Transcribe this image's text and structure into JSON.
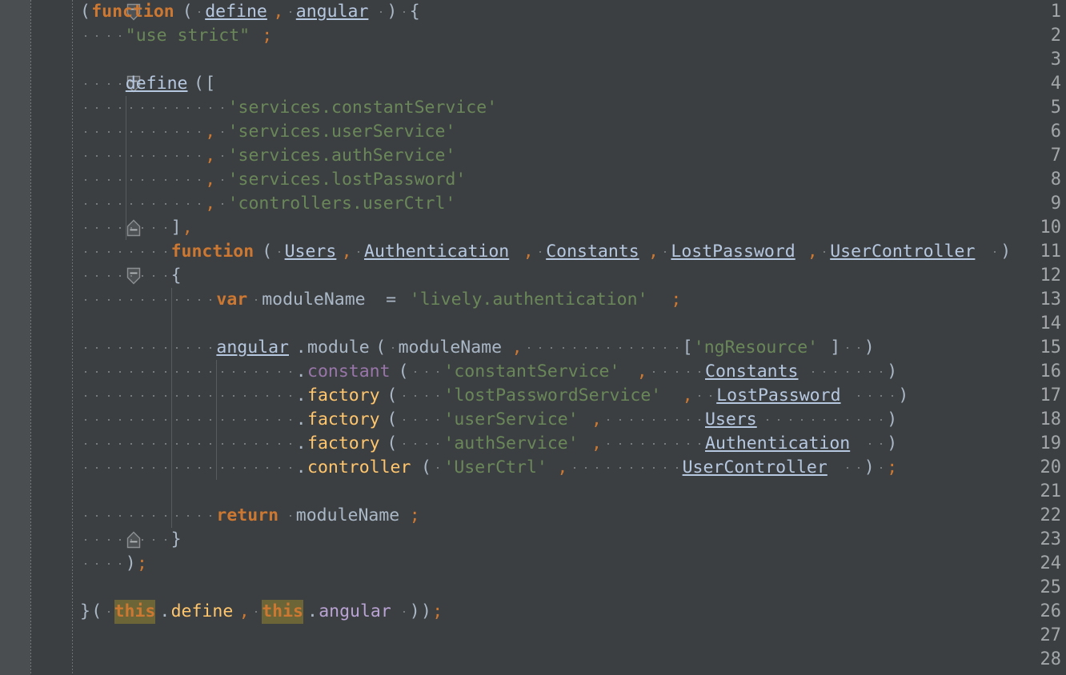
{
  "editor": {
    "theme_name": "darcula",
    "colors": {
      "background": "#3c3f41",
      "gutter_background": "#4b4e50",
      "line_number": "#a3a6a8",
      "default_text": "#a9b7c6",
      "keyword": "#cc7832",
      "string": "#6a8759",
      "function_name": "#ffc66d",
      "purple_method": "#9876aa",
      "parameter_underlined": "#b6c7e0",
      "this_highlight_background": "#6b6538",
      "indent_guide": "#585b5d",
      "whitespace_dot": "#787b7d"
    },
    "total_lines": 28,
    "first_visible_line": 1,
    "language": "JavaScript",
    "show_whitespace_dots": true,
    "show_indent_guides": true,
    "char_width": 14.2,
    "line_height": 30
  },
  "gutter": {
    "line_numbers": [
      1,
      2,
      3,
      4,
      5,
      6,
      7,
      8,
      9,
      10,
      11,
      12,
      13,
      14,
      15,
      16,
      17,
      18,
      19,
      20,
      21,
      22,
      23,
      24,
      25,
      26,
      27,
      28
    ],
    "fold_markers": [
      {
        "line": 1,
        "type": "fold-start",
        "icon": "fold-collapse-icon"
      },
      {
        "line": 4,
        "type": "fold-start",
        "icon": "fold-collapse-icon"
      },
      {
        "line": 10,
        "type": "fold-end",
        "icon": "fold-end-icon"
      },
      {
        "line": 12,
        "type": "fold-start",
        "icon": "fold-collapse-icon"
      },
      {
        "line": 23,
        "type": "fold-end",
        "icon": "fold-end-icon"
      },
      {
        "line": 26,
        "type": "fold-end",
        "icon": "fold-end-icon"
      }
    ]
  },
  "code": {
    "lines": [
      {
        "n": 1,
        "indent": 0,
        "guides": [],
        "tokens": [
          {
            "t": "(",
            "c": "punc"
          },
          {
            "t": "function",
            "c": "kw"
          },
          {
            "t": "(",
            "c": "punc"
          },
          {
            "t": " ",
            "c": "punc"
          },
          {
            "t": "define",
            "c": "param"
          },
          {
            "t": ",",
            "c": "comma"
          },
          {
            "t": " ",
            "c": "punc"
          },
          {
            "t": "angular",
            "c": "param"
          },
          {
            "t": " ",
            "c": "punc"
          },
          {
            "t": ")",
            "c": "punc"
          },
          {
            "t": " ",
            "c": "punc"
          },
          {
            "t": "{",
            "c": "punc"
          }
        ]
      },
      {
        "n": 2,
        "indent": 0,
        "guides": [],
        "tokens": [
          {
            "t": "    ",
            "c": "punc"
          },
          {
            "t": "\"use strict\"",
            "c": "str"
          },
          {
            "t": ";",
            "c": "comma"
          }
        ]
      },
      {
        "n": 3,
        "indent": 0,
        "guides": [],
        "tokens": []
      },
      {
        "n": 4,
        "indent": 0,
        "guides": [],
        "tokens": [
          {
            "t": "    ",
            "c": "punc"
          },
          {
            "t": "define",
            "c": "defunder"
          },
          {
            "t": "(",
            "c": "punc"
          },
          {
            "t": "[",
            "c": "punc"
          }
        ]
      },
      {
        "n": 5,
        "indent": 0,
        "guides": [
          4
        ],
        "tokens": [
          {
            "t": "             ",
            "c": "punc"
          },
          {
            "t": "'services.constantService'",
            "c": "str"
          }
        ]
      },
      {
        "n": 6,
        "indent": 0,
        "guides": [
          4
        ],
        "tokens": [
          {
            "t": "           ",
            "c": "punc"
          },
          {
            "t": ",",
            "c": "comma"
          },
          {
            "t": " ",
            "c": "punc"
          },
          {
            "t": "'services.userService'",
            "c": "str"
          }
        ]
      },
      {
        "n": 7,
        "indent": 0,
        "guides": [
          4
        ],
        "tokens": [
          {
            "t": "           ",
            "c": "punc"
          },
          {
            "t": ",",
            "c": "comma"
          },
          {
            "t": " ",
            "c": "punc"
          },
          {
            "t": "'services.authService'",
            "c": "str"
          }
        ]
      },
      {
        "n": 8,
        "indent": 0,
        "guides": [
          4
        ],
        "tokens": [
          {
            "t": "           ",
            "c": "punc"
          },
          {
            "t": ",",
            "c": "comma"
          },
          {
            "t": " ",
            "c": "punc"
          },
          {
            "t": "'services.lostPassword'",
            "c": "str"
          }
        ]
      },
      {
        "n": 9,
        "indent": 0,
        "guides": [
          4
        ],
        "tokens": [
          {
            "t": "           ",
            "c": "punc"
          },
          {
            "t": ",",
            "c": "comma"
          },
          {
            "t": " ",
            "c": "punc"
          },
          {
            "t": "'controllers.userCtrl'",
            "c": "str"
          }
        ]
      },
      {
        "n": 10,
        "indent": 0,
        "guides": [
          4
        ],
        "tokens": [
          {
            "t": "        ",
            "c": "punc"
          },
          {
            "t": "]",
            "c": "punc"
          },
          {
            "t": ",",
            "c": "comma"
          }
        ]
      },
      {
        "n": 11,
        "indent": 0,
        "guides": [],
        "tokens": [
          {
            "t": "        ",
            "c": "punc"
          },
          {
            "t": "function",
            "c": "kw"
          },
          {
            "t": "(",
            "c": "punc"
          },
          {
            "t": " ",
            "c": "punc"
          },
          {
            "t": "Users",
            "c": "param"
          },
          {
            "t": ",",
            "c": "comma"
          },
          {
            "t": " ",
            "c": "punc"
          },
          {
            "t": "Authentication",
            "c": "param"
          },
          {
            "t": ",",
            "c": "comma"
          },
          {
            "t": " ",
            "c": "punc"
          },
          {
            "t": "Constants",
            "c": "param"
          },
          {
            "t": ",",
            "c": "comma"
          },
          {
            "t": " ",
            "c": "punc"
          },
          {
            "t": "LostPassword",
            "c": "param"
          },
          {
            "t": ",",
            "c": "comma"
          },
          {
            "t": " ",
            "c": "punc"
          },
          {
            "t": "UserController",
            "c": "param"
          },
          {
            "t": " ",
            "c": "punc"
          },
          {
            "t": ")",
            "c": "punc"
          }
        ]
      },
      {
        "n": 12,
        "indent": 0,
        "guides": [],
        "tokens": [
          {
            "t": "        ",
            "c": "punc"
          },
          {
            "t": "{",
            "c": "punc"
          }
        ]
      },
      {
        "n": 13,
        "indent": 0,
        "guides": [
          8
        ],
        "tokens": [
          {
            "t": "            ",
            "c": "punc"
          },
          {
            "t": "var",
            "c": "kw"
          },
          {
            "t": " ",
            "c": "punc"
          },
          {
            "t": "moduleName",
            "c": "ident"
          },
          {
            "t": " = ",
            "c": "punc"
          },
          {
            "t": "'lively.authentication'",
            "c": "str"
          },
          {
            "t": ";",
            "c": "comma"
          }
        ]
      },
      {
        "n": 14,
        "indent": 0,
        "guides": [
          8
        ],
        "tokens": []
      },
      {
        "n": 15,
        "indent": 0,
        "guides": [
          8
        ],
        "tokens": [
          {
            "t": "            ",
            "c": "punc"
          },
          {
            "t": "angular",
            "c": "defunder"
          },
          {
            "t": ".",
            "c": "punc"
          },
          {
            "t": "module",
            "c": "ident"
          },
          {
            "t": "(",
            "c": "punc"
          },
          {
            "t": " ",
            "c": "punc"
          },
          {
            "t": "moduleName",
            "c": "ident"
          },
          {
            "t": ",",
            "c": "comma"
          },
          {
            "t": "              ",
            "c": "punc"
          },
          {
            "t": "[",
            "c": "punc"
          },
          {
            "t": "'ngResource'",
            "c": "str"
          },
          {
            "t": "]",
            "c": "punc"
          },
          {
            "t": "  ",
            "c": "punc"
          },
          {
            "t": ")",
            "c": "punc"
          }
        ]
      },
      {
        "n": 16,
        "indent": 0,
        "guides": [
          8,
          12
        ],
        "tokens": [
          {
            "t": "                   ",
            "c": "punc"
          },
          {
            "t": ".",
            "c": "punc"
          },
          {
            "t": "constant",
            "c": "fnpurple"
          },
          {
            "t": "(",
            "c": "punc"
          },
          {
            "t": "   ",
            "c": "punc"
          },
          {
            "t": "'constantService'",
            "c": "str"
          },
          {
            "t": ",",
            "c": "comma"
          },
          {
            "t": "     ",
            "c": "punc"
          },
          {
            "t": "Constants",
            "c": "param"
          },
          {
            "t": "       ",
            "c": "punc"
          },
          {
            "t": ")",
            "c": "punc"
          }
        ]
      },
      {
        "n": 17,
        "indent": 0,
        "guides": [
          8,
          12
        ],
        "tokens": [
          {
            "t": "                   ",
            "c": "punc"
          },
          {
            "t": ".",
            "c": "punc"
          },
          {
            "t": "factory",
            "c": "fnorange"
          },
          {
            "t": "(",
            "c": "punc"
          },
          {
            "t": "    ",
            "c": "punc"
          },
          {
            "t": "'lostPasswordService'",
            "c": "str"
          },
          {
            "t": ",",
            "c": "comma"
          },
          {
            "t": "  ",
            "c": "punc"
          },
          {
            "t": "LostPassword",
            "c": "param"
          },
          {
            "t": "    ",
            "c": "punc"
          },
          {
            "t": ")",
            "c": "punc"
          }
        ]
      },
      {
        "n": 18,
        "indent": 0,
        "guides": [
          8,
          12
        ],
        "tokens": [
          {
            "t": "                   ",
            "c": "punc"
          },
          {
            "t": ".",
            "c": "punc"
          },
          {
            "t": "factory",
            "c": "fnorange"
          },
          {
            "t": "(",
            "c": "punc"
          },
          {
            "t": "    ",
            "c": "punc"
          },
          {
            "t": "'userService'",
            "c": "str"
          },
          {
            "t": ",",
            "c": "comma"
          },
          {
            "t": "         ",
            "c": "punc"
          },
          {
            "t": "Users",
            "c": "param"
          },
          {
            "t": "           ",
            "c": "punc"
          },
          {
            "t": ")",
            "c": "punc"
          }
        ]
      },
      {
        "n": 19,
        "indent": 0,
        "guides": [
          8,
          12
        ],
        "tokens": [
          {
            "t": "                   ",
            "c": "punc"
          },
          {
            "t": ".",
            "c": "punc"
          },
          {
            "t": "factory",
            "c": "fnorange"
          },
          {
            "t": "(",
            "c": "punc"
          },
          {
            "t": "    ",
            "c": "punc"
          },
          {
            "t": "'authService'",
            "c": "str"
          },
          {
            "t": ",",
            "c": "comma"
          },
          {
            "t": "         ",
            "c": "punc"
          },
          {
            "t": "Authentication",
            "c": "param"
          },
          {
            "t": "  ",
            "c": "punc"
          },
          {
            "t": ")",
            "c": "punc"
          }
        ]
      },
      {
        "n": 20,
        "indent": 0,
        "guides": [
          8,
          12
        ],
        "tokens": [
          {
            "t": "                   ",
            "c": "punc"
          },
          {
            "t": ".",
            "c": "punc"
          },
          {
            "t": "controller",
            "c": "fnorange"
          },
          {
            "t": "(",
            "c": "punc"
          },
          {
            "t": " ",
            "c": "punc"
          },
          {
            "t": "'UserCtrl'",
            "c": "str"
          },
          {
            "t": ",",
            "c": "comma"
          },
          {
            "t": "          ",
            "c": "punc"
          },
          {
            "t": "UserController",
            "c": "param"
          },
          {
            "t": "  ",
            "c": "punc"
          },
          {
            "t": ")",
            "c": "punc"
          },
          {
            "t": " ",
            "c": "punc"
          },
          {
            "t": ";",
            "c": "comma"
          }
        ]
      },
      {
        "n": 21,
        "indent": 0,
        "guides": [
          8
        ],
        "tokens": []
      },
      {
        "n": 22,
        "indent": 0,
        "guides": [
          8
        ],
        "tokens": [
          {
            "t": "            ",
            "c": "punc"
          },
          {
            "t": "return",
            "c": "kw"
          },
          {
            "t": " ",
            "c": "punc"
          },
          {
            "t": "moduleName",
            "c": "ident"
          },
          {
            "t": ";",
            "c": "comma"
          }
        ]
      },
      {
        "n": 23,
        "indent": 0,
        "guides": [],
        "tokens": [
          {
            "t": "        ",
            "c": "punc"
          },
          {
            "t": "}",
            "c": "punc"
          }
        ]
      },
      {
        "n": 24,
        "indent": 0,
        "guides": [],
        "tokens": [
          {
            "t": "    ",
            "c": "punc"
          },
          {
            "t": ")",
            "c": "punc"
          },
          {
            "t": ";",
            "c": "comma"
          }
        ]
      },
      {
        "n": 25,
        "indent": 0,
        "guides": [],
        "tokens": []
      },
      {
        "n": 26,
        "indent": 0,
        "guides": [],
        "tokens": [
          {
            "t": "}",
            "c": "punc"
          },
          {
            "t": "(",
            "c": "punc"
          },
          {
            "t": " ",
            "c": "punc"
          },
          {
            "t": "this",
            "c": "thisbg"
          },
          {
            "t": ".",
            "c": "punc"
          },
          {
            "t": "define",
            "c": "yellow"
          },
          {
            "t": ",",
            "c": "comma"
          },
          {
            "t": " ",
            "c": "punc"
          },
          {
            "t": "this",
            "c": "thisbg"
          },
          {
            "t": ".",
            "c": "punc"
          },
          {
            "t": "angular",
            "c": "dotpurple"
          },
          {
            "t": " ",
            "c": "punc"
          },
          {
            "t": ")",
            "c": "punc"
          },
          {
            "t": ")",
            "c": "punc"
          },
          {
            "t": ";",
            "c": "comma"
          }
        ]
      },
      {
        "n": 27,
        "indent": 0,
        "guides": [],
        "tokens": []
      },
      {
        "n": 28,
        "indent": 0,
        "guides": [],
        "tokens": []
      }
    ],
    "plain_text": [
      "(function( define, angular ) {",
      "    \"use strict\";",
      "",
      "    define([",
      "             'services.constantService'",
      "           , 'services.userService'",
      "           , 'services.authService'",
      "           , 'services.lostPassword'",
      "           , 'controllers.userCtrl'",
      "        ],",
      "        function( Users, Authentication, Constants, LostPassword, UserController )",
      "        {",
      "            var moduleName = 'lively.authentication';",
      "",
      "            angular.module( moduleName,              ['ngResource']  )",
      "                   .constant(   'constantService',     Constants       )",
      "                   .factory(    'lostPasswordService',  LostPassword    )",
      "                   .factory(    'userService',         Users           )",
      "                   .factory(    'authService',         Authentication  )",
      "                   .controller( 'UserCtrl',          UserController  ) ;",
      "",
      "            return moduleName;",
      "        }",
      "    );",
      "",
      "}( this.define, this.angular ));",
      "",
      ""
    ]
  }
}
